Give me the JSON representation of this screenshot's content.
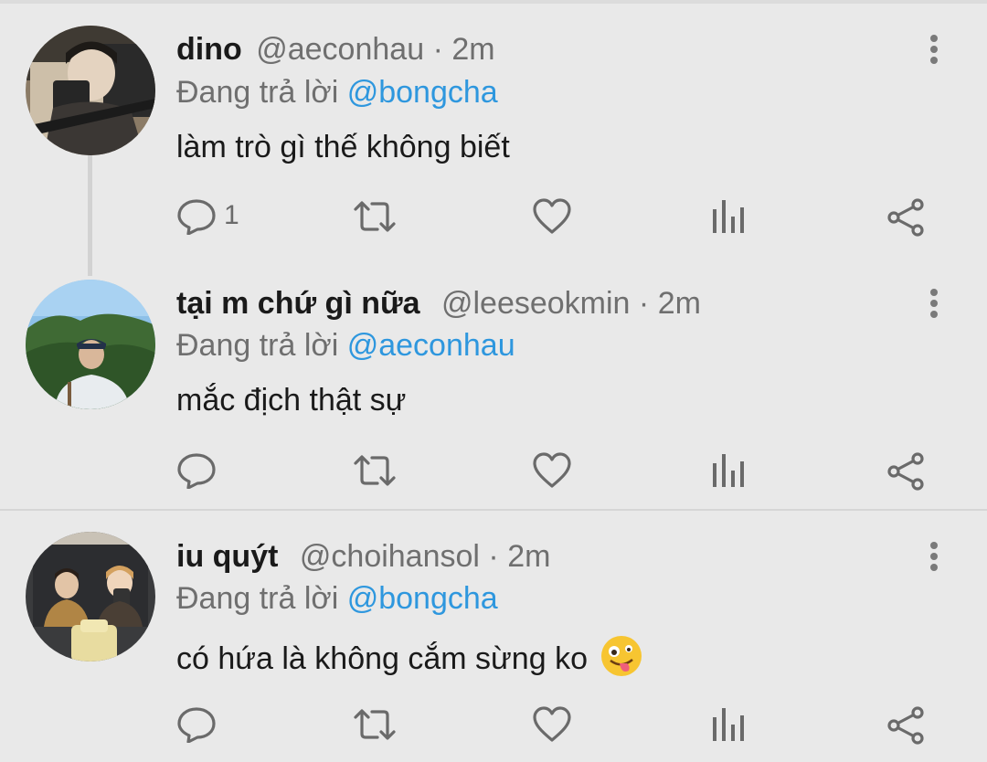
{
  "colors": {
    "background": "#e9e9e9",
    "mention": "#2e97de",
    "muted": "#6f6f6f"
  },
  "tweets": [
    {
      "name": "dino",
      "handle": "@aeconhau",
      "separator": "·",
      "time": "2m",
      "reply_prefix": "Đang trả lời",
      "reply_to": "@bongcha",
      "text": "làm trò gì thế không biết",
      "reply_count": "1"
    },
    {
      "name": "tại m chứ gì nữa",
      "handle": "@leeseokmin",
      "separator": "·",
      "time": "2m",
      "reply_prefix": "Đang trả lời",
      "reply_to": "@aeconhau",
      "text": "mắc địch thật sự",
      "reply_count": ""
    },
    {
      "name": "iu quýt",
      "handle": "@choihansol",
      "separator": "·",
      "time": "2m",
      "reply_prefix": "Đang trả lời",
      "reply_to": "@bongcha",
      "text": "có hứa là không cắm sừng ko",
      "reply_count": ""
    }
  ],
  "icons": [
    "reply-icon",
    "retweet-icon",
    "like-icon",
    "analytics-icon",
    "share-icon",
    "more-icon",
    "zany-face-emoji"
  ]
}
